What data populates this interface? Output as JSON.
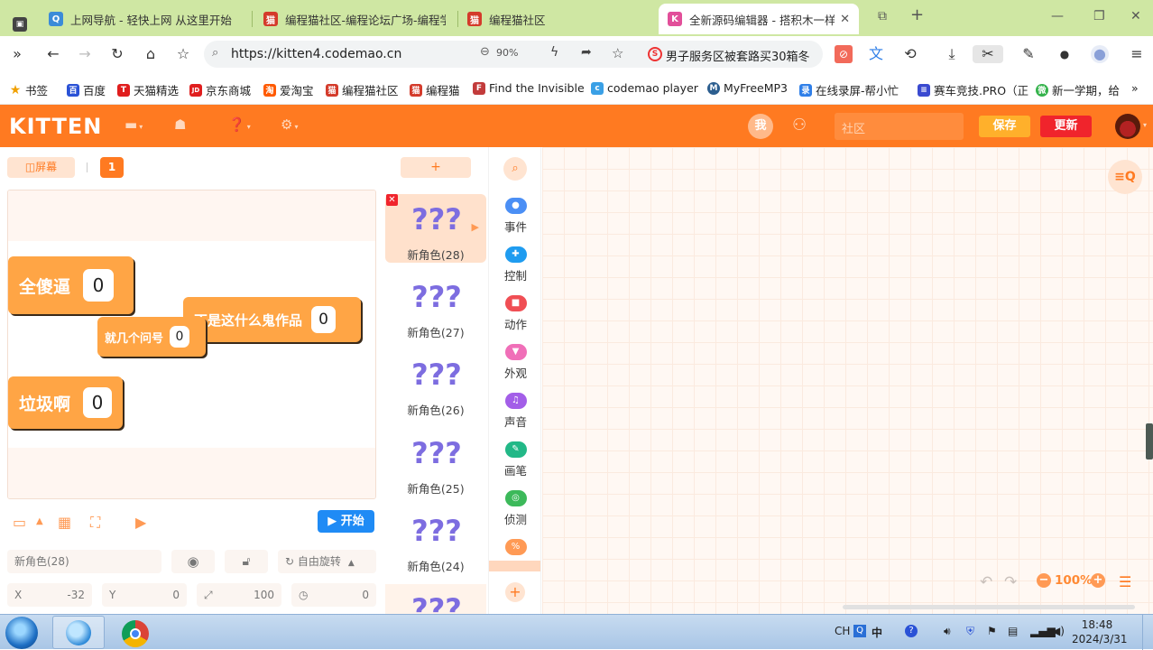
{
  "browser": {
    "tabs": [
      {
        "title": "上网导航 - 轻快上网 从这里开始",
        "color": "#3b8bd8",
        "glyph": "Q"
      },
      {
        "title": "编程猫社区-编程论坛广场-编程学",
        "color": "#d43b2b",
        "glyph": "猫"
      },
      {
        "title": "编程猫社区",
        "color": "#d43b2b",
        "glyph": "猫"
      },
      {
        "title": "全新源码编辑器 - 搭积木一样来",
        "color": "#e24f9a",
        "glyph": "K"
      }
    ],
    "url": "https://kitten4.codemao.cn",
    "zoom": "90%",
    "news": "男子服务区被套路买30箱冬",
    "bookmarks": [
      {
        "label": "书签",
        "color": "#f0a000",
        "glyph": "★"
      },
      {
        "label": "百度",
        "color": "#2a52d6",
        "glyph": "百"
      },
      {
        "label": "天猫精选",
        "color": "#e01e1e",
        "glyph": "T"
      },
      {
        "label": "京东商城",
        "color": "#e01e1e",
        "glyph": "JD"
      },
      {
        "label": "爱淘宝",
        "color": "#ff5a00",
        "glyph": "淘"
      },
      {
        "label": "编程猫社区",
        "color": "#d43b2b",
        "glyph": "猫"
      },
      {
        "label": "编程猫",
        "color": "#d43b2b",
        "glyph": "猫"
      },
      {
        "label": "Find the Invisible",
        "color": "#c23b3b",
        "glyph": "F"
      },
      {
        "label": "codemao player",
        "color": "#3aa0e6",
        "glyph": "c"
      },
      {
        "label": "MyFreeMP3",
        "color": "#2c5e8f",
        "glyph": "M"
      },
      {
        "label": "在线录屏-帮小忙",
        "color": "#2f7fe8",
        "glyph": "录"
      },
      {
        "label": "赛车竞技.PRO（正",
        "color": "#3a4ad0",
        "glyph": "≡"
      },
      {
        "label": "新一学期，给",
        "color": "#33b24a",
        "glyph": "微"
      }
    ]
  },
  "kitten": {
    "logo": "KITTEN",
    "avatar_me": "我",
    "community_placeholder": "社区",
    "save": "保存",
    "update": "更新"
  },
  "stage": {
    "screen_button": "屏幕",
    "screen_number": "1",
    "start_button": "开始",
    "variables": [
      {
        "name": "全傻逼",
        "value": "0"
      },
      {
        "name": "不是这什么鬼作品",
        "value": "0"
      },
      {
        "name": "就几个问号",
        "value": "0"
      },
      {
        "name": "垃圾啊",
        "value": "0"
      }
    ],
    "properties": {
      "sprite_name": "新角色(28)",
      "rotation_mode": "自由旋转",
      "x_label": "X",
      "x_value": "-32",
      "y_label": "Y",
      "y_value": "0",
      "size_value": "100",
      "direction_value": "0"
    }
  },
  "sprites": {
    "add_label": "+",
    "items": [
      {
        "name": "新角色(28)",
        "thumb": "???"
      },
      {
        "name": "新角色(27)",
        "thumb": "???"
      },
      {
        "name": "新角色(26)",
        "thumb": "???"
      },
      {
        "name": "新角色(25)",
        "thumb": "???"
      },
      {
        "name": "新角色(24)",
        "thumb": "???"
      },
      {
        "name": "",
        "thumb": "???"
      }
    ]
  },
  "categories": [
    {
      "label": "事件",
      "color": "#4b8ff5"
    },
    {
      "label": "控制",
      "color": "#1f9cf0"
    },
    {
      "label": "动作",
      "color": "#f04e54"
    },
    {
      "label": "外观",
      "color": "#f06fb8"
    },
    {
      "label": "声音",
      "color": "#a35ee8"
    },
    {
      "label": "画笔",
      "color": "#22b887"
    },
    {
      "label": "侦测",
      "color": "#3cb95a"
    },
    {
      "label": "运算",
      "color": "#ff9a55"
    }
  ],
  "workspace": {
    "zoom": "100%"
  },
  "taskbar": {
    "time": "18:48",
    "date": "2024/3/31",
    "lang": "CH",
    "ime": "中"
  }
}
